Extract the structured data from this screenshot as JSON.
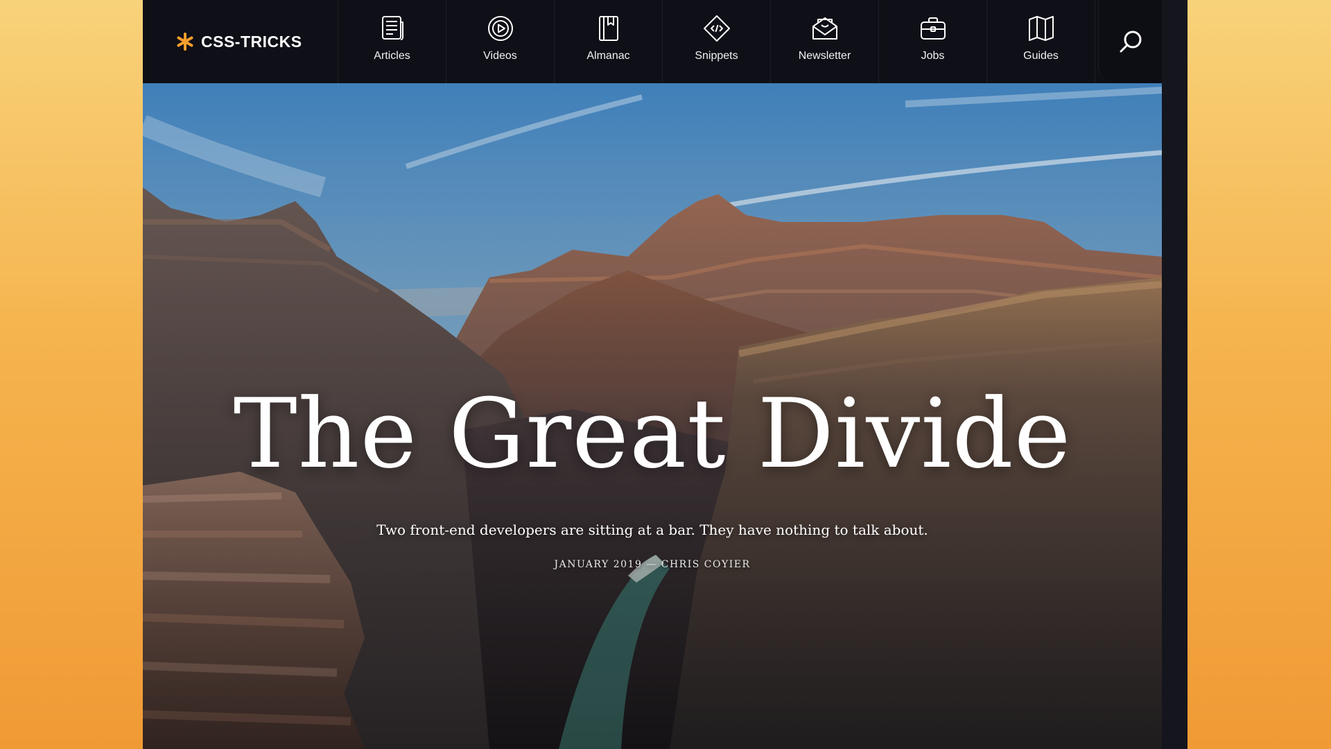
{
  "brand": {
    "name": "CSS-TRICKS",
    "accent_color": "#f59e2d"
  },
  "nav": {
    "items": [
      {
        "label": "Articles",
        "icon": "newspaper-icon"
      },
      {
        "label": "Videos",
        "icon": "play-circle-icon"
      },
      {
        "label": "Almanac",
        "icon": "bookmark-book-icon"
      },
      {
        "label": "Snippets",
        "icon": "code-diamond-icon"
      },
      {
        "label": "Newsletter",
        "icon": "envelope-icon"
      },
      {
        "label": "Jobs",
        "icon": "briefcase-icon"
      },
      {
        "label": "Guides",
        "icon": "map-icon"
      }
    ],
    "search_icon": "search-icon"
  },
  "hero": {
    "title": "The Great Divide",
    "subtitle": "Two front-end developers are sitting at a bar. They have nothing to talk about.",
    "meta": "JANUARY 2019 — CHRIS COYIER",
    "image": "canyon-landscape"
  }
}
